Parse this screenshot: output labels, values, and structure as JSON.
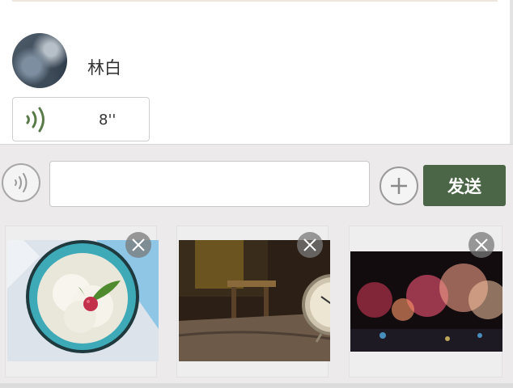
{
  "chat": {
    "username": "林白",
    "voice_message": {
      "duration": "8''"
    }
  },
  "composer": {
    "input_value": "",
    "input_placeholder": "",
    "send_label": "发送"
  },
  "attachments": [
    {
      "description_icon": "image-thumbnail",
      "remove_icon": "close-icon"
    },
    {
      "description_icon": "image-thumbnail",
      "remove_icon": "close-icon"
    },
    {
      "description_icon": "image-thumbnail",
      "remove_icon": "close-icon"
    }
  ],
  "colors": {
    "send_button": "#4b6646",
    "voice_wave": "#5a7a4a"
  }
}
